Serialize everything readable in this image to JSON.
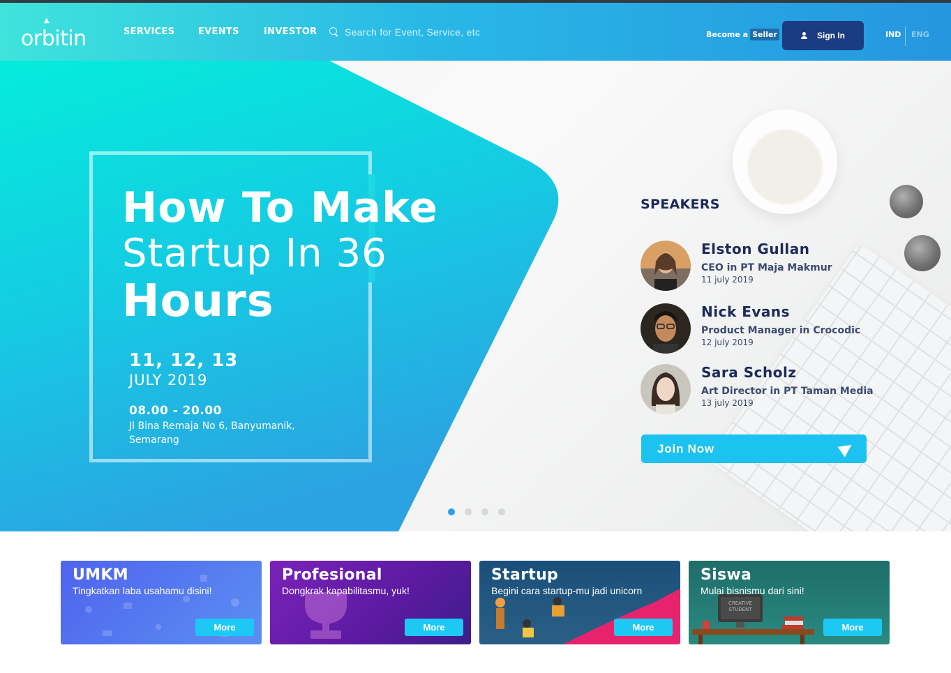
{
  "brand": {
    "name": "orbitin"
  },
  "nav": {
    "services": "SERVICES",
    "events": "EVENTS",
    "investor": "INVESTOR"
  },
  "search": {
    "placeholder": "Search for Event, Service, etc"
  },
  "account": {
    "become": "Become a",
    "seller": "Seller",
    "signin": "Sign In"
  },
  "lang": {
    "ind": "IND",
    "eng": "ENG",
    "active": "IND"
  },
  "hero": {
    "title_line1": "How To Make",
    "title_line2": "Startup In 36",
    "title_line3": "Hours",
    "dates": "11, 12, 13",
    "month": "JULY 2019",
    "time": "08.00  - 20.00",
    "address": "Jl Bina Remaja No 6, Banyumanik, Semarang",
    "speakers_title": "SPEAKERS",
    "speakers": [
      {
        "name": "Elston Gullan",
        "role": "CEO in PT Maja Makmur",
        "date": "11 july 2019"
      },
      {
        "name": "Nick Evans",
        "role": "Product Manager in Crocodic",
        "date": "12 july 2019"
      },
      {
        "name": "Sara Scholz",
        "role": "Art Director in PT Taman Media",
        "date": "13 july 2019"
      }
    ],
    "join": "Join Now",
    "slides": {
      "count": 4,
      "active": 1
    }
  },
  "categories": [
    {
      "title": "UMKM",
      "subtitle": "Tingkatkan laba usahamu disini!",
      "more": "More"
    },
    {
      "title": "Profesional",
      "subtitle": "Dongkrak kapabilitasmu, yuk!",
      "more": "More"
    },
    {
      "title": "Startup",
      "subtitle": "Begini cara startup-mu jadi unicorn",
      "more": "More"
    },
    {
      "title": "Siswa",
      "subtitle": "Mulai bisnismu dari sini!",
      "more": "More",
      "monitor_text": "CREATIVE STUDENT"
    }
  ],
  "colors": {
    "accent": "#1cc2f0",
    "navy": "#1b2a59",
    "signin_bg": "#1b3c82"
  }
}
